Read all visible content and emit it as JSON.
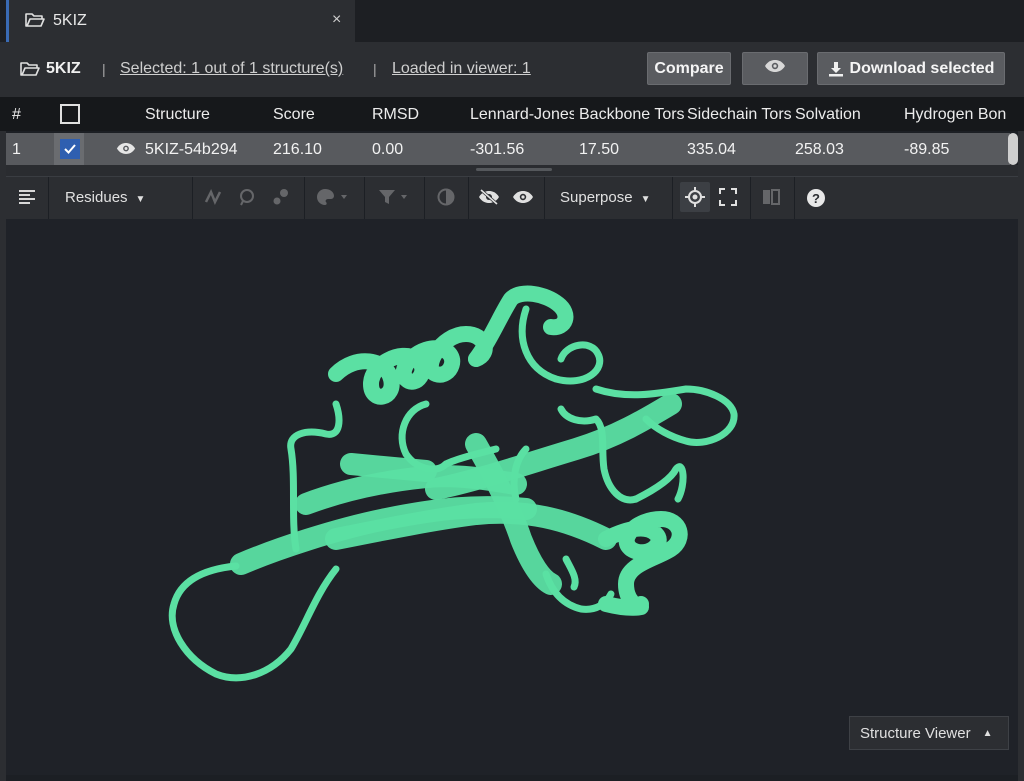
{
  "tab": {
    "title": "5KIZ",
    "close_symbol": "×"
  },
  "header": {
    "name": "5KIZ",
    "separator": "|",
    "selected_link": "Selected: 1 out of 1 structure(s)",
    "loaded_link": "Loaded in viewer: 1",
    "compare_label": "Compare",
    "download_label": "Download selected"
  },
  "table": {
    "columns": [
      "#",
      "Structure",
      "Score",
      "RMSD",
      "Lennard-Jones",
      "Backbone Torsion",
      "Sidechain Torsion",
      "Solvation",
      "Hydrogen Bon"
    ],
    "row": {
      "index": "1",
      "structure": "5KIZ-54b294",
      "score": "216.10",
      "rmsd": "0.00",
      "lennard_jones": "-301.56",
      "backbone": "17.50",
      "sidechain": "335.04",
      "solvation": "258.03",
      "hydrogen": "-89.85"
    }
  },
  "toolbar": {
    "residues_label": "Residues",
    "superpose_label": "Superpose"
  },
  "viewer": {
    "mode_label": "Structure Viewer",
    "protein_color": "#5be0a3"
  }
}
